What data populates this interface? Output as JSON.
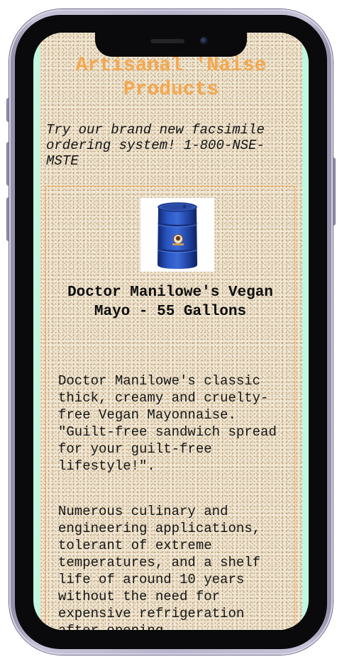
{
  "header": {
    "title": "Artisanal 'Naise Products"
  },
  "promo": {
    "text": "Try our brand new facsimile ordering system! 1-800-NSE-MSTE"
  },
  "product": {
    "image_icon": "blue-barrel-image",
    "name": "Doctor Manilowe's Vegan Mayo - 55 Gallons",
    "description_1": "Doctor Manilowe's classic thick, creamy and cruelty-free Vegan Mayonnaise. \"Guilt-free sandwich spread for your guilt-free lifestyle!\".",
    "description_2": "Numerous culinary and engineering applications, tolerant of extreme temperatures, and a shelf life of around 10 years without the need for expensive refrigeration after opening."
  },
  "colors": {
    "title": "#f4a84e",
    "card_border": "#f2a857",
    "screen_side": "#bff8e0",
    "page_background": "#eee3cc",
    "barrel": "#1f47b0"
  }
}
